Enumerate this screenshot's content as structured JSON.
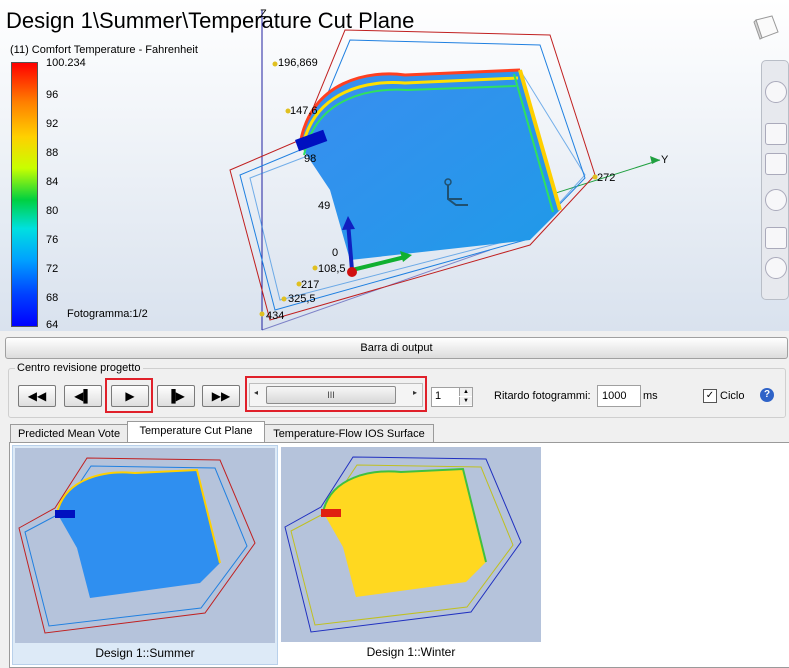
{
  "viewport": {
    "title": "Design 1\\Summer\\Temperature Cut Plane",
    "legend": {
      "title": "(11) Comfort Temperature - Fahrenheit",
      "max_label": "100.234",
      "ticks": [
        "96",
        "92",
        "88",
        "84",
        "80",
        "76",
        "72",
        "68",
        "64"
      ],
      "frame_label": "Fotogramma:1/2"
    },
    "axis": {
      "z_label": "Z",
      "y_label": "Y",
      "values": [
        "196,869",
        "147,6",
        "98",
        "49",
        "0",
        "108,5",
        "217",
        "325,5",
        "434",
        "272"
      ]
    }
  },
  "output_bar": {
    "label": "Barra di output"
  },
  "review_center": {
    "title": "Centro revisione progetto",
    "buttons": {
      "rewind": "◀◀",
      "step_back": "◀▌",
      "play": "▶",
      "step_forward": "▐▶",
      "fast_forward": "▶▶"
    },
    "slider": {
      "left_arrow": "◂",
      "right_arrow": "▸",
      "thumb_grip": "III"
    },
    "frame_spinner": {
      "value": "1"
    },
    "delay_label": "Ritardo fotogrammi:",
    "delay_value": "1000",
    "delay_unit": "ms",
    "loop_label": "Ciclo",
    "loop_checked": true,
    "help_icon": "?"
  },
  "tabs": [
    {
      "label": "Predicted Mean Vote"
    },
    {
      "label": "Temperature Cut Plane"
    },
    {
      "label": "Temperature-Flow IOS Surface"
    }
  ],
  "thumbnails": [
    {
      "caption": "Design 1::Summer",
      "colorscheme": "cold"
    },
    {
      "caption": "Design 1::Winter",
      "colorscheme": "warm"
    }
  ],
  "colors": {
    "highlight": "#e0202a",
    "accent": "#2f63c8"
  }
}
